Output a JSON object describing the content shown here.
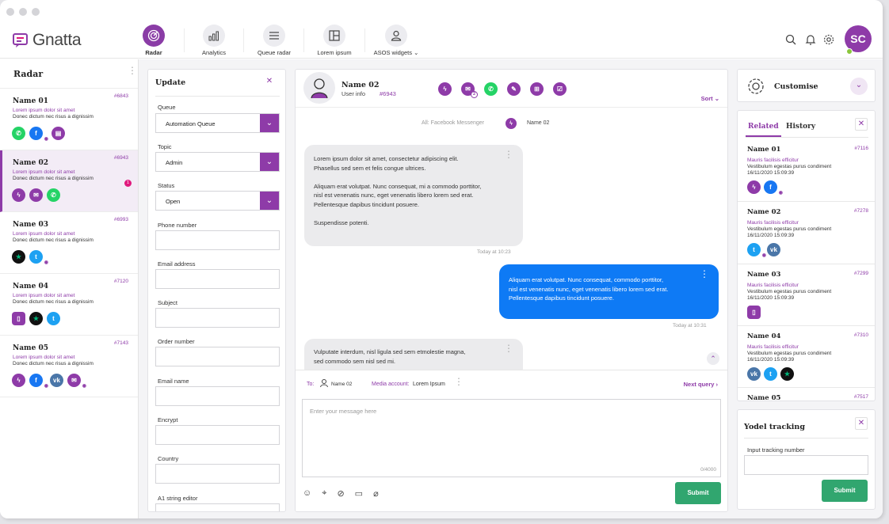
{
  "app": {
    "name": "Gnatta"
  },
  "nav": [
    {
      "label": "Radar",
      "icon": "radar-icon"
    },
    {
      "label": "Analytics",
      "icon": "analytics-icon"
    },
    {
      "label": "Queue radar",
      "icon": "list-icon"
    },
    {
      "label": "Lorem ipsum",
      "icon": "layout-icon"
    },
    {
      "label": "ASOS widgets",
      "icon": "user-icon"
    }
  ],
  "user": {
    "initials": "SC"
  },
  "radar": {
    "title": "Radar",
    "items": [
      {
        "name": "Name 01",
        "id": "#6843",
        "line1": "Lorem ipsum dolor sit amet",
        "line2": "Donec dictum nec risus a dignissim",
        "channels": [
          "whatsapp",
          "facebook",
          "chat"
        ]
      },
      {
        "name": "Name 02",
        "id": "#6943",
        "line1": "Lorem ipsum dolor sit amet",
        "line2": "Donec dictum nec risus a dignissim",
        "badge": "1",
        "channels": [
          "messenger",
          "email",
          "whatsapp"
        ]
      },
      {
        "name": "Name 03",
        "id": "#6993",
        "line1": "Lorem ipsum dolor sit amet",
        "line2": "Donec dictum nec risus a dignissim",
        "channels": [
          "trustpilot",
          "twitter"
        ]
      },
      {
        "name": "Name 04",
        "id": "#7120",
        "line1": "Lorem ipsum dolor sit amet",
        "line2": "Donec dictum nec risus a dignissim",
        "channels": [
          "phone",
          "trustpilot",
          "twitter"
        ]
      },
      {
        "name": "Name 05",
        "id": "#7143",
        "line1": "Lorem ipsum dolor sit amet",
        "line2": "Donec dictum nec risus a dignissim",
        "channels": [
          "messenger",
          "facebook",
          "vk",
          "email"
        ]
      }
    ]
  },
  "update": {
    "title": "Update",
    "queue_label": "Queue",
    "queue_value": "Automation Queue",
    "topic_label": "Topic",
    "topic_value": "Admin",
    "status_label": "Status",
    "status_value": "Open",
    "fields": [
      "Phone number",
      "Email address",
      "Subject",
      "Order number",
      "Email name",
      "Encrypt",
      "Country",
      "A1 string editor"
    ]
  },
  "chat": {
    "name": "Name 02",
    "user_info": "User info",
    "id": "#6943",
    "sort": "Sort",
    "channel_note_prefix": "All: Facebook Messenger",
    "channel_note_name": "Name 02",
    "msg1": [
      "Lorem ipsum dolor sit amet, consectetur adipiscing elit.",
      "Phasellus sed sem et felis congue ultrices.",
      "",
      "Aliquam erat volutpat. Nunc consequat, mi a commodo porttitor,",
      "nisl est venenatis nunc, eget venenatis libero lorem sed erat.",
      "Pellentesque dapibus tincidunt posuere.",
      "",
      "Suspendisse potenti."
    ],
    "time1": "Today at 10:23",
    "msg2": [
      "Aliquam erat volutpat. Nunc consequat, commodo porttitor,",
      "nisl est venenatis nunc, eget venenatis libero lorem sed erat.",
      "Pellentesque dapibus tincidunt posuere."
    ],
    "time2": "Today at 10:31",
    "msg3": [
      "Vulputate interdum, nisl ligula sed sem etmolestie magna,",
      "sed commodo sem nisl sed mi."
    ],
    "to_label": "To:",
    "to_name": "Name 02",
    "media_label": "Media account:",
    "media_value": "Lorem Ipsum",
    "next_query": "Next query",
    "placeholder": "Enter your message here",
    "counter": "0/4000",
    "submit": "Submit",
    "email_badge": "2"
  },
  "customise": {
    "title": "Customise"
  },
  "related": {
    "tab_related": "Related",
    "tab_history": "History",
    "items": [
      {
        "name": "Name 01",
        "id": "#7116",
        "l1": "Mauris facilisis efficitur",
        "l2": "Vestibulum egestas purus condiment",
        "l3": "16/11/2020  15:09:39",
        "channels": [
          "messenger",
          "facebook"
        ]
      },
      {
        "name": "Name 02",
        "id": "#7278",
        "l1": "Mauris facilisis efficitur",
        "l2": "Vestibulum egestas purus condiment",
        "l3": "16/11/2020  15:09:39",
        "channels": [
          "twitter",
          "vk"
        ]
      },
      {
        "name": "Name 03",
        "id": "#7299",
        "l1": "Mauris facilisis efficitur",
        "l2": "Vestibulum egestas purus condiment",
        "l3": "16/11/2020  15:09:39",
        "channels": [
          "phone"
        ]
      },
      {
        "name": "Name 04",
        "id": "#7310",
        "l1": "Mauris facilisis efficitur",
        "l2": "Vestibulum egestas purus condiment",
        "l3": "16/11/2020  15:09:39",
        "channels": [
          "vk",
          "twitter",
          "trustpilot"
        ]
      },
      {
        "name": "Name 05",
        "id": "#7517"
      }
    ]
  },
  "yodel": {
    "title": "Yodel tracking",
    "input_label": "Input tracking number",
    "submit": "Submit"
  },
  "colors": {
    "brand": "#8e3ba8",
    "primary_blue": "#0e7af5",
    "submit_green": "#31a66f"
  }
}
